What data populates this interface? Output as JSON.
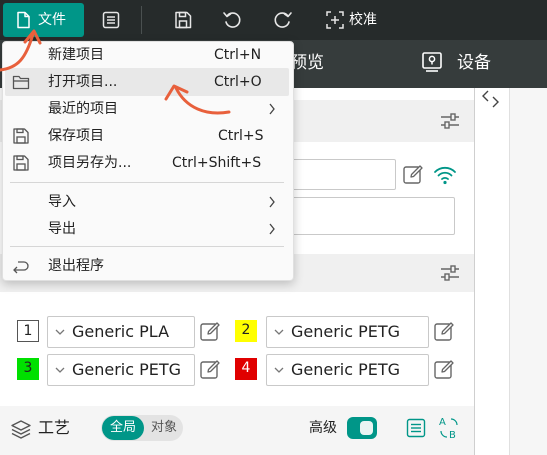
{
  "toolbar": {
    "file_label": "文件",
    "calibrate_label": "校准"
  },
  "tabs": {
    "preview_label": "预览",
    "device_label": "设备"
  },
  "menu": {
    "items": [
      {
        "label": "新建项目",
        "shortcut": "Ctrl+N"
      },
      {
        "label": "打开项目...",
        "shortcut": "Ctrl+O"
      },
      {
        "label": "最近的项目",
        "shortcut": ""
      },
      {
        "label": "保存项目",
        "shortcut": "Ctrl+S"
      },
      {
        "label": "项目另存为...",
        "shortcut": "Ctrl+Shift+S"
      },
      {
        "label": "导入",
        "shortcut": ""
      },
      {
        "label": "导出",
        "shortcut": ""
      },
      {
        "label": "退出程序",
        "shortcut": ""
      }
    ]
  },
  "filaments": [
    {
      "slot": "1",
      "name": "Generic PLA"
    },
    {
      "slot": "2",
      "name": "Generic PETG"
    },
    {
      "slot": "3",
      "name": "Generic PETG"
    },
    {
      "slot": "4",
      "name": "Generic PETG"
    }
  ],
  "process": {
    "title": "工艺",
    "scope_global": "全局",
    "scope_object": "对象",
    "advanced_label": "高级",
    "advanced_on": true
  },
  "colors": {
    "accent": "#009688",
    "toolbar_bg": "#262b2b",
    "secondary_bg": "#363c3c",
    "annotation": "#e8603c"
  }
}
